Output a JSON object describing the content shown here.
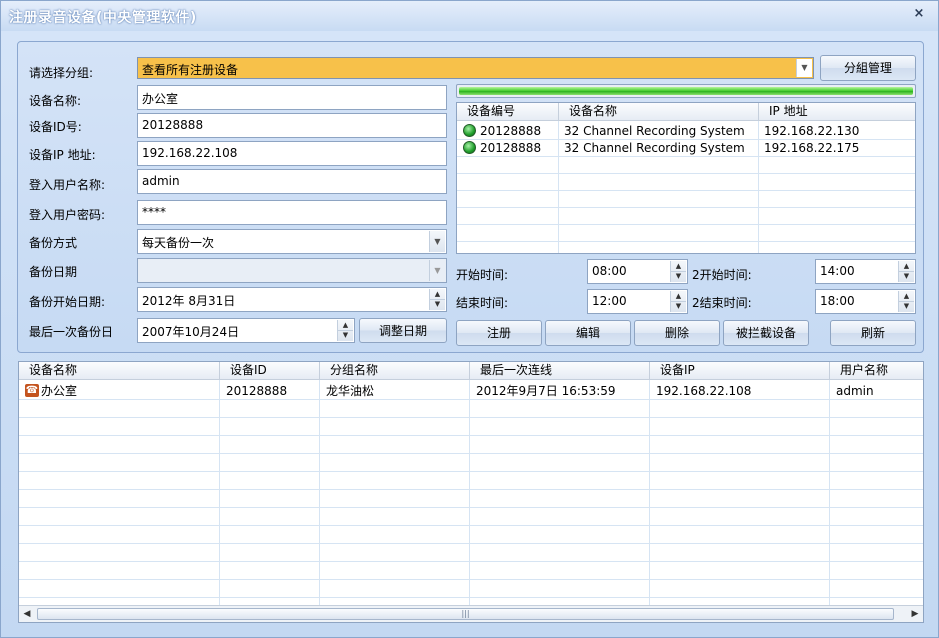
{
  "window": {
    "title": "注册录音设备(中央管理软件)",
    "close_symbol": "×"
  },
  "form": {
    "group_label": "请选择分组:",
    "group_value": "查看所有注册设备",
    "group_manage_button": "分組管理",
    "device_name_label": "设备名称:",
    "device_name_value": "办公室",
    "device_id_label": "设备ID号:",
    "device_id_value": "20128888",
    "device_ip_label": "设备IP 地址:",
    "device_ip_value": "192.168.22.108",
    "login_user_label": "登入用户名称:",
    "login_user_value": "admin",
    "login_password_label": "登入用户密码:",
    "login_password_value": "****",
    "backup_mode_label": "备份方式",
    "backup_mode_value": "每天备份一次",
    "backup_date_label": "备份日期",
    "backup_date_value": "",
    "backup_start_label": "备份开始日期:",
    "backup_start_value": "2012年  8月31日",
    "last_backup_label": "最后一次备份日",
    "last_backup_value": "2007年10月24日",
    "adjust_date_button": "调整日期"
  },
  "progress": {
    "value": 1.0,
    "color": "#3fcb2a"
  },
  "device_list": {
    "columns": [
      "设备编号",
      "设备名称",
      "IP 地址"
    ],
    "rows": [
      {
        "id": "20128888",
        "name": "32 Channel Recording System",
        "ip": "192.168.22.130",
        "status_icon": "green-led-icon"
      },
      {
        "id": "20128888",
        "name": "32 Channel Recording System",
        "ip": "192.168.22.175",
        "status_icon": "green-led-icon"
      }
    ]
  },
  "schedule": {
    "start_label": "开始时间:",
    "start_value": "08:00",
    "end_label": "结束时间:",
    "end_value": "12:00",
    "start2_label": "2开始时间:",
    "start2_value": "14:00",
    "end2_label": "2结束时间:",
    "end2_value": "18:00"
  },
  "actions": {
    "register": "注册",
    "edit": "编辑",
    "delete": "删除",
    "intercepted": "被拦截设备",
    "refresh": "刷新"
  },
  "registered_table": {
    "columns": [
      "设备名称",
      "设备ID",
      "分组名称",
      "最后一次连线",
      "设备IP",
      "用户名称"
    ],
    "rows": [
      {
        "name": "办公室",
        "id": "20128888",
        "group": "龙华油松",
        "last_connect": "2012年9月7日 16:53:59",
        "ip": "192.168.22.108",
        "user": "admin",
        "icon": "phone-icon"
      }
    ]
  },
  "scrollbar": {
    "left_arrow": "◀",
    "right_arrow": "▶",
    "grip": "|||"
  }
}
